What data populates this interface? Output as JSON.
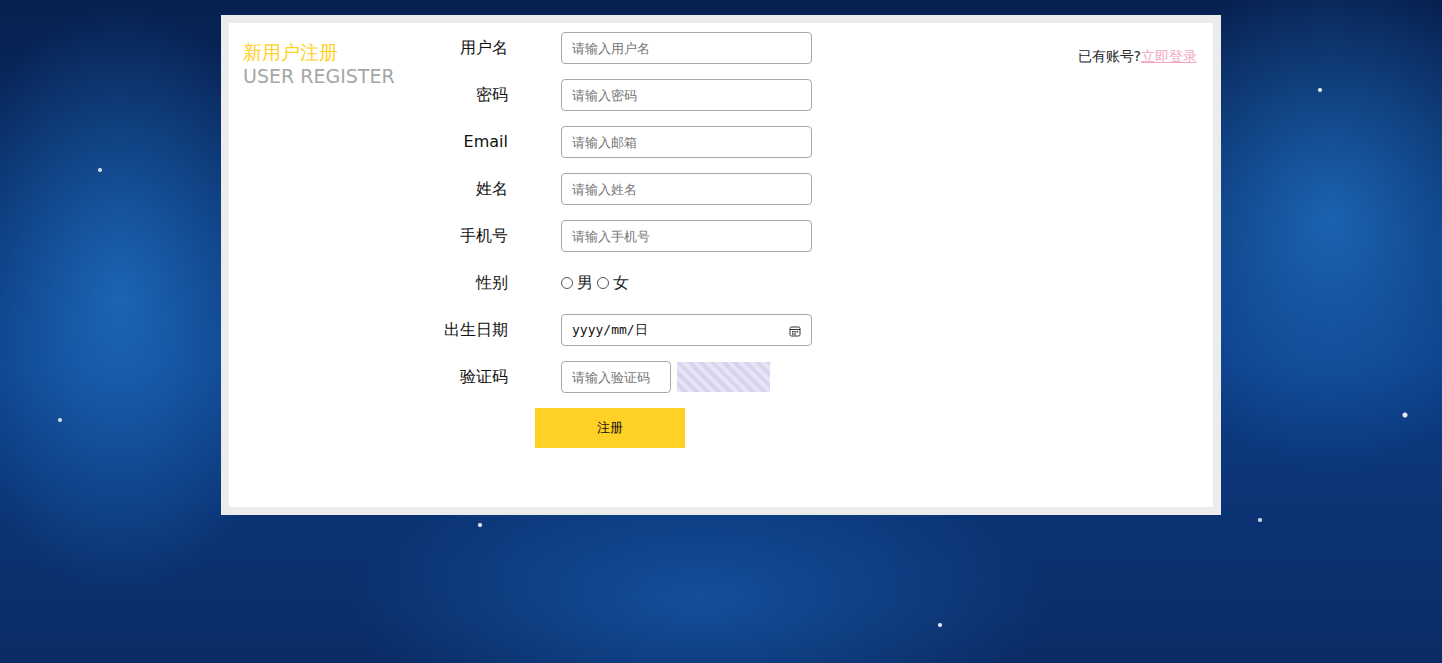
{
  "header": {
    "title": "新用户注册",
    "subtitle": "USER REGISTER"
  },
  "login": {
    "prompt": "已有账号?",
    "link": "立即登录"
  },
  "fields": [
    {
      "kind": "text",
      "label": "用户名",
      "placeholder": "请输入用户名"
    },
    {
      "kind": "text",
      "label": "密码",
      "placeholder": "请输入密码"
    },
    {
      "kind": "text",
      "label": "Email",
      "placeholder": "请输入邮箱"
    },
    {
      "kind": "text",
      "label": "姓名",
      "placeholder": "请输入姓名"
    },
    {
      "kind": "text",
      "label": "手机号",
      "placeholder": "请输入手机号"
    },
    {
      "kind": "radio",
      "label": "性别",
      "options": [
        {
          "label": "男",
          "selected": false
        },
        {
          "label": "女",
          "selected": false
        }
      ]
    },
    {
      "kind": "date",
      "label": "出生日期",
      "value": "yyyy/mm/日"
    },
    {
      "kind": "captcha",
      "label": "验证码",
      "placeholder": "请输入验证码"
    }
  ],
  "submit": "注册"
}
